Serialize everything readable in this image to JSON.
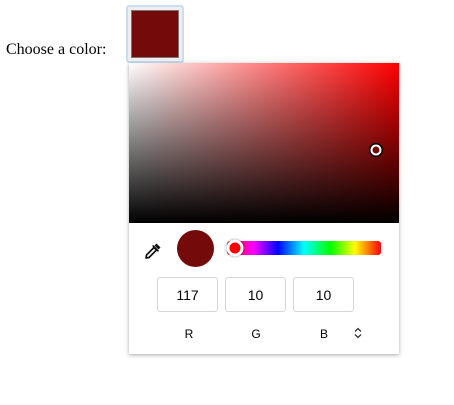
{
  "label": {
    "text": "Choose a color:"
  },
  "color": {
    "hex": "#750a0a",
    "hue_hex": "#ff0000"
  },
  "picker": {
    "saturation": 0.915,
    "value": 0.459,
    "hue": 0
  },
  "inputs": {
    "r": {
      "value": "117",
      "label": "R"
    },
    "g": {
      "value": "10",
      "label": "G"
    },
    "b": {
      "value": "10",
      "label": "B"
    }
  },
  "icons": {
    "eyedropper": "eyedropper-icon",
    "mode_toggle": "chevron-up-down-icon"
  }
}
